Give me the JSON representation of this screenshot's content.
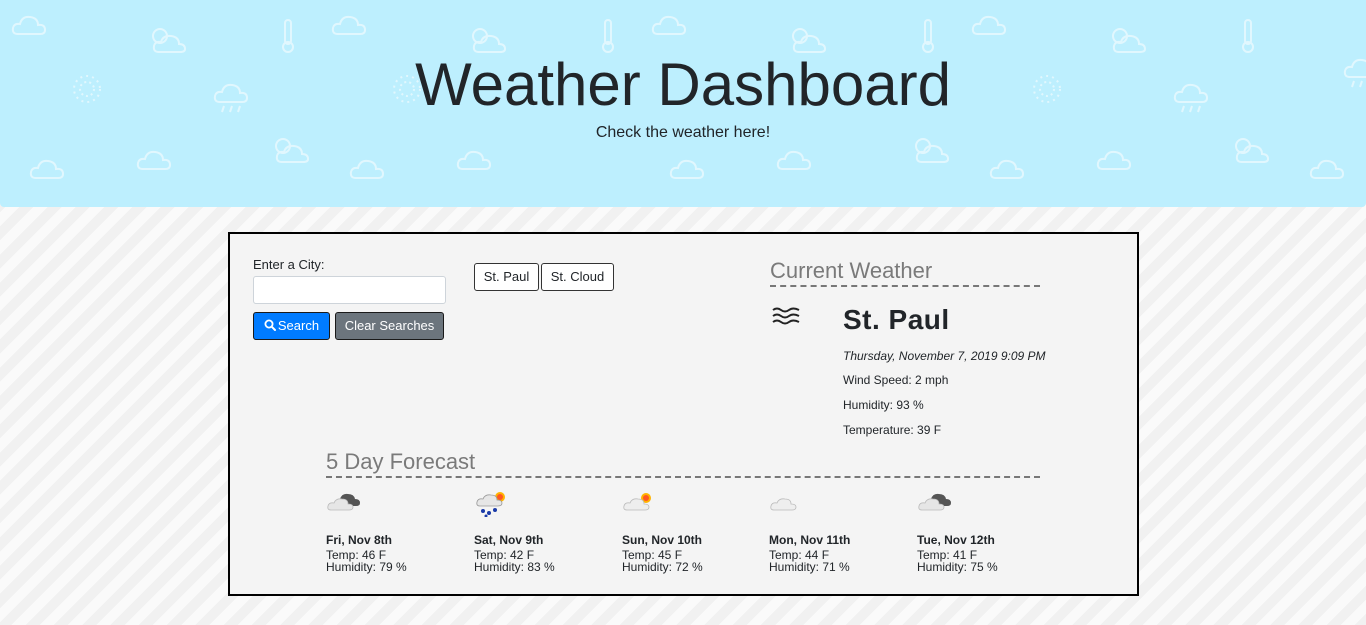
{
  "header": {
    "title": "Weather Dashboard",
    "subtitle": "Check the weather here!"
  },
  "search": {
    "label": "Enter a City:",
    "value": "",
    "placeholder": "",
    "search_label": "Search",
    "clear_label": "Clear Searches",
    "search_icon": "magnifier-icon"
  },
  "history": [
    "St. Paul",
    "St. Cloud"
  ],
  "current": {
    "section_title": "Current Weather",
    "icon": "wind-icon",
    "city": "St. Paul",
    "date": "Thursday, November 7, 2019 9:09 PM",
    "wind": "Wind Speed: 2 mph",
    "humidity": "Humidity: 93 %",
    "temperature": "Temperature: 39 F"
  },
  "forecast": {
    "section_title": "5 Day Forecast",
    "days": [
      {
        "date": "Fri, Nov 8th",
        "temp": "Temp: 46 F",
        "humidity": "Humidity: 79 %",
        "icon": "cloudy-icon"
      },
      {
        "date": "Sat, Nov 9th",
        "temp": "Temp: 42 F",
        "humidity": "Humidity: 83 %",
        "icon": "rain-sun-icon"
      },
      {
        "date": "Sun, Nov 10th",
        "temp": "Temp: 45 F",
        "humidity": "Humidity: 72 %",
        "icon": "partly-sunny-icon"
      },
      {
        "date": "Mon, Nov 11th",
        "temp": "Temp: 44 F",
        "humidity": "Humidity: 71 %",
        "icon": "cloud-icon"
      },
      {
        "date": "Tue, Nov 12th",
        "temp": "Temp: 41 F",
        "humidity": "Humidity: 75 %",
        "icon": "cloudy-icon"
      }
    ]
  },
  "colors": {
    "header_bg": "#bdeffe",
    "primary": "#007bff",
    "secondary": "#6c757d"
  }
}
